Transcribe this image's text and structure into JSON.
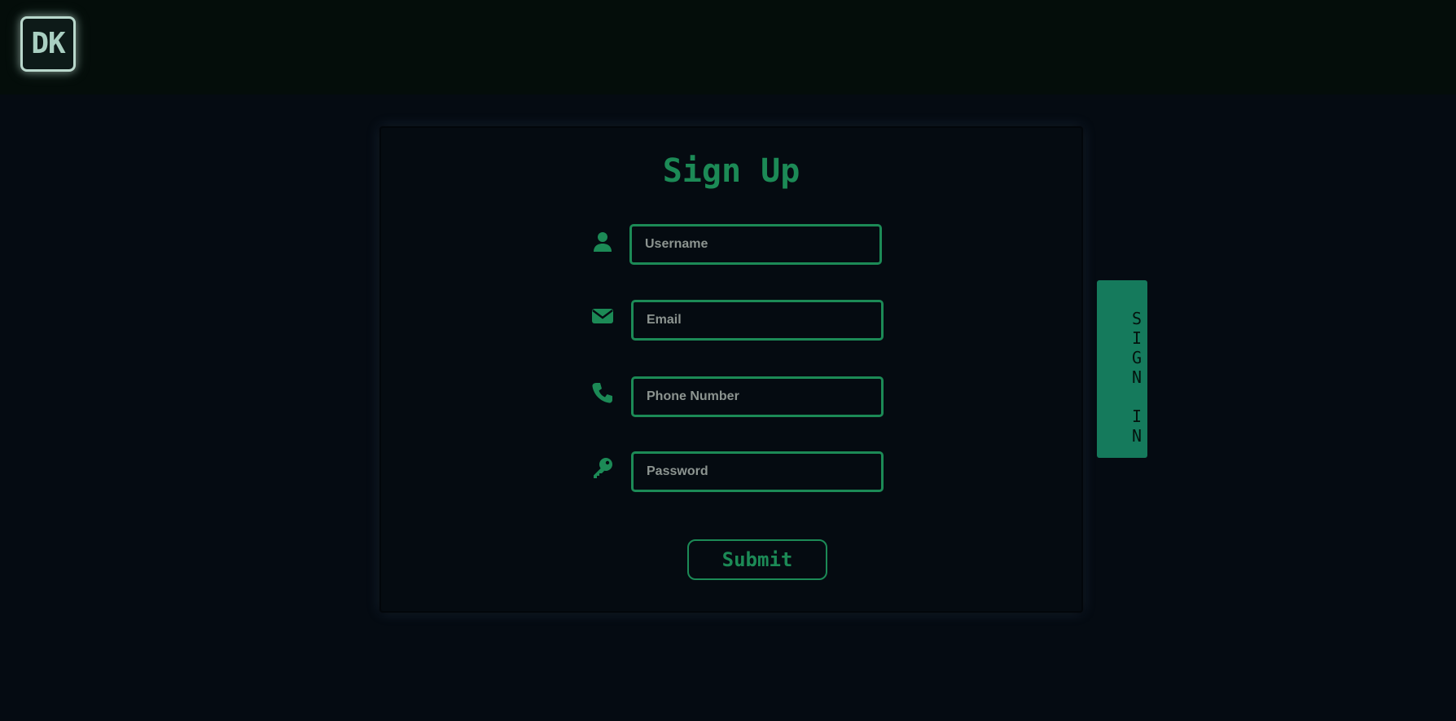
{
  "header": {
    "logo_text": "DK"
  },
  "signup": {
    "title": "Sign Up",
    "fields": [
      {
        "icon": "user-icon",
        "placeholder": "Username",
        "value": ""
      },
      {
        "icon": "envelope-icon",
        "placeholder": "Email",
        "value": ""
      },
      {
        "icon": "phone-icon",
        "placeholder": "Phone Number",
        "value": ""
      },
      {
        "icon": "key-icon",
        "placeholder": "Password",
        "value": ""
      }
    ],
    "submit_label": "Submit"
  },
  "side_tab": {
    "label": "SIGN IN"
  },
  "colors": {
    "page_background": "#050b12",
    "header_background": "#040d0a",
    "accent_green": "#1c8a56",
    "tab_green": "#157a5c",
    "logo_border": "#b9d8cc",
    "placeholder": "#8c9490"
  }
}
